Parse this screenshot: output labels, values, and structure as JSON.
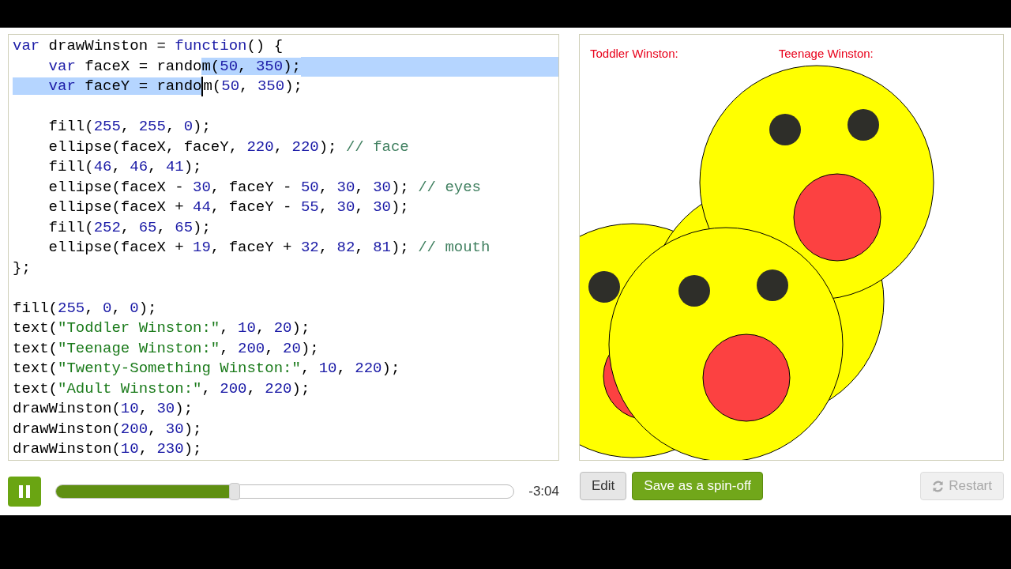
{
  "editor": {
    "lines": [
      {
        "kind": "code",
        "tokens": [
          {
            "t": "var",
            "kind": "keyword"
          },
          {
            "t": " drawWinston = ",
            "kind": "plain"
          },
          {
            "t": "function",
            "kind": "keyword"
          },
          {
            "t": "() {",
            "kind": "plain"
          }
        ]
      },
      {
        "kind": "code",
        "selection_to_eol": true,
        "tokens": [
          {
            "t": "    var",
            "kind": "keyword",
            "selected": false
          },
          {
            "t": " faceX = rando",
            "kind": "plain",
            "selected": false
          },
          {
            "t": "m(",
            "kind": "plain",
            "selected": true
          },
          {
            "t": "50",
            "kind": "number",
            "selected": true
          },
          {
            "t": ", ",
            "kind": "plain",
            "selected": true
          },
          {
            "t": "350",
            "kind": "number",
            "selected": true
          },
          {
            "t": ");",
            "kind": "plain",
            "selected": true
          }
        ]
      },
      {
        "kind": "code",
        "tokens": [
          {
            "t": "    var",
            "kind": "keyword",
            "selected": true
          },
          {
            "t": " faceY = rando",
            "kind": "plain",
            "selected": true,
            "caret": true
          },
          {
            "t": "m(",
            "kind": "plain",
            "selected": false
          },
          {
            "t": "50",
            "kind": "number",
            "selected": false
          },
          {
            "t": ", ",
            "kind": "plain",
            "selected": false
          },
          {
            "t": "350",
            "kind": "number",
            "selected": false
          },
          {
            "t": ");",
            "kind": "plain",
            "selected": false
          }
        ]
      },
      {
        "kind": "blank"
      },
      {
        "kind": "code",
        "tokens": [
          {
            "t": "    fill(",
            "kind": "plain"
          },
          {
            "t": "255",
            "kind": "number"
          },
          {
            "t": ", ",
            "kind": "plain"
          },
          {
            "t": "255",
            "kind": "number"
          },
          {
            "t": ", ",
            "kind": "plain"
          },
          {
            "t": "0",
            "kind": "number"
          },
          {
            "t": ");",
            "kind": "plain"
          }
        ]
      },
      {
        "kind": "code",
        "tokens": [
          {
            "t": "    ellipse(faceX, faceY, ",
            "kind": "plain"
          },
          {
            "t": "220",
            "kind": "number"
          },
          {
            "t": ", ",
            "kind": "plain"
          },
          {
            "t": "220",
            "kind": "number"
          },
          {
            "t": "); ",
            "kind": "plain"
          },
          {
            "t": "// face",
            "kind": "comment"
          }
        ]
      },
      {
        "kind": "code",
        "tokens": [
          {
            "t": "    fill(",
            "kind": "plain"
          },
          {
            "t": "46",
            "kind": "number"
          },
          {
            "t": ", ",
            "kind": "plain"
          },
          {
            "t": "46",
            "kind": "number"
          },
          {
            "t": ", ",
            "kind": "plain"
          },
          {
            "t": "41",
            "kind": "number"
          },
          {
            "t": ");",
            "kind": "plain"
          }
        ]
      },
      {
        "kind": "code",
        "tokens": [
          {
            "t": "    ellipse(faceX - ",
            "kind": "plain"
          },
          {
            "t": "30",
            "kind": "number"
          },
          {
            "t": ", faceY - ",
            "kind": "plain"
          },
          {
            "t": "50",
            "kind": "number"
          },
          {
            "t": ", ",
            "kind": "plain"
          },
          {
            "t": "30",
            "kind": "number"
          },
          {
            "t": ", ",
            "kind": "plain"
          },
          {
            "t": "30",
            "kind": "number"
          },
          {
            "t": "); ",
            "kind": "plain"
          },
          {
            "t": "// eyes",
            "kind": "comment"
          }
        ]
      },
      {
        "kind": "code",
        "tokens": [
          {
            "t": "    ellipse(faceX + ",
            "kind": "plain"
          },
          {
            "t": "44",
            "kind": "number"
          },
          {
            "t": ", faceY - ",
            "kind": "plain"
          },
          {
            "t": "55",
            "kind": "number"
          },
          {
            "t": ", ",
            "kind": "plain"
          },
          {
            "t": "30",
            "kind": "number"
          },
          {
            "t": ", ",
            "kind": "plain"
          },
          {
            "t": "30",
            "kind": "number"
          },
          {
            "t": ");",
            "kind": "plain"
          }
        ]
      },
      {
        "kind": "code",
        "tokens": [
          {
            "t": "    fill(",
            "kind": "plain"
          },
          {
            "t": "252",
            "kind": "number"
          },
          {
            "t": ", ",
            "kind": "plain"
          },
          {
            "t": "65",
            "kind": "number"
          },
          {
            "t": ", ",
            "kind": "plain"
          },
          {
            "t": "65",
            "kind": "number"
          },
          {
            "t": ");",
            "kind": "plain"
          }
        ]
      },
      {
        "kind": "code",
        "tokens": [
          {
            "t": "    ellipse(faceX + ",
            "kind": "plain"
          },
          {
            "t": "19",
            "kind": "number"
          },
          {
            "t": ", faceY + ",
            "kind": "plain"
          },
          {
            "t": "32",
            "kind": "number"
          },
          {
            "t": ", ",
            "kind": "plain"
          },
          {
            "t": "82",
            "kind": "number"
          },
          {
            "t": ", ",
            "kind": "plain"
          },
          {
            "t": "81",
            "kind": "number"
          },
          {
            "t": "); ",
            "kind": "plain"
          },
          {
            "t": "// mouth",
            "kind": "comment"
          }
        ]
      },
      {
        "kind": "code",
        "tokens": [
          {
            "t": "};",
            "kind": "plain"
          }
        ]
      },
      {
        "kind": "blank"
      },
      {
        "kind": "code",
        "tokens": [
          {
            "t": "fill(",
            "kind": "plain"
          },
          {
            "t": "255",
            "kind": "number"
          },
          {
            "t": ", ",
            "kind": "plain"
          },
          {
            "t": "0",
            "kind": "number"
          },
          {
            "t": ", ",
            "kind": "plain"
          },
          {
            "t": "0",
            "kind": "number"
          },
          {
            "t": ");",
            "kind": "plain"
          }
        ]
      },
      {
        "kind": "code",
        "tokens": [
          {
            "t": "text(",
            "kind": "plain"
          },
          {
            "t": "\"Toddler Winston:\"",
            "kind": "string"
          },
          {
            "t": ", ",
            "kind": "plain"
          },
          {
            "t": "10",
            "kind": "number"
          },
          {
            "t": ", ",
            "kind": "plain"
          },
          {
            "t": "20",
            "kind": "number"
          },
          {
            "t": ");",
            "kind": "plain"
          }
        ]
      },
      {
        "kind": "code",
        "tokens": [
          {
            "t": "text(",
            "kind": "plain"
          },
          {
            "t": "\"Teenage Winston:\"",
            "kind": "string"
          },
          {
            "t": ", ",
            "kind": "plain"
          },
          {
            "t": "200",
            "kind": "number"
          },
          {
            "t": ", ",
            "kind": "plain"
          },
          {
            "t": "20",
            "kind": "number"
          },
          {
            "t": ");",
            "kind": "plain"
          }
        ]
      },
      {
        "kind": "code",
        "tokens": [
          {
            "t": "text(",
            "kind": "plain"
          },
          {
            "t": "\"Twenty-Something Winston:\"",
            "kind": "string"
          },
          {
            "t": ", ",
            "kind": "plain"
          },
          {
            "t": "10",
            "kind": "number"
          },
          {
            "t": ", ",
            "kind": "plain"
          },
          {
            "t": "220",
            "kind": "number"
          },
          {
            "t": ");",
            "kind": "plain"
          }
        ]
      },
      {
        "kind": "code",
        "tokens": [
          {
            "t": "text(",
            "kind": "plain"
          },
          {
            "t": "\"Adult Winston:\"",
            "kind": "string"
          },
          {
            "t": ", ",
            "kind": "plain"
          },
          {
            "t": "200",
            "kind": "number"
          },
          {
            "t": ", ",
            "kind": "plain"
          },
          {
            "t": "220",
            "kind": "number"
          },
          {
            "t": ");",
            "kind": "plain"
          }
        ]
      },
      {
        "kind": "code",
        "tokens": [
          {
            "t": "drawWinston(",
            "kind": "plain"
          },
          {
            "t": "10",
            "kind": "number"
          },
          {
            "t": ", ",
            "kind": "plain"
          },
          {
            "t": "30",
            "kind": "number"
          },
          {
            "t": ");",
            "kind": "plain"
          }
        ]
      },
      {
        "kind": "code",
        "tokens": [
          {
            "t": "drawWinston(",
            "kind": "plain"
          },
          {
            "t": "200",
            "kind": "number"
          },
          {
            "t": ", ",
            "kind": "plain"
          },
          {
            "t": "30",
            "kind": "number"
          },
          {
            "t": ");",
            "kind": "plain"
          }
        ]
      },
      {
        "kind": "code",
        "tokens": [
          {
            "t": "drawWinston(",
            "kind": "plain"
          },
          {
            "t": "10",
            "kind": "number"
          },
          {
            "t": ", ",
            "kind": "plain"
          },
          {
            "t": "230",
            "kind": "number"
          },
          {
            "t": ");",
            "kind": "plain"
          }
        ]
      }
    ]
  },
  "canvas": {
    "labels": [
      "Toddler Winston:",
      "Teenage Winston:"
    ]
  },
  "player": {
    "playing": true,
    "level": 0.39,
    "time": "-3:04"
  },
  "buttons": [
    {
      "label": "Edit",
      "kind": "plain",
      "disabled": false
    },
    {
      "label": "Save as a spin-off",
      "kind": "primary",
      "disabled": false
    },
    {
      "label": "Restart",
      "kind": "restart",
      "disabled": true
    }
  ]
}
